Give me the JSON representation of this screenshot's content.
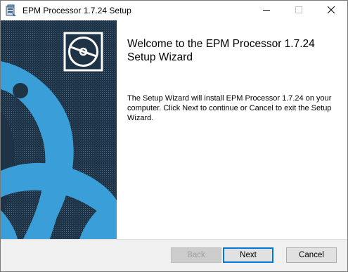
{
  "window": {
    "title": "EPM Processor 1.7.24 Setup"
  },
  "titlebar_controls": {
    "minimize_icon": "minimize-icon",
    "maximize_icon": "maximize-icon",
    "close_icon": "close-icon"
  },
  "wizard": {
    "heading": "Welcome to the EPM Processor 1.7.24 Setup Wizard",
    "description": "The Setup Wizard will install EPM Processor 1.7.24 on your computer. Click Next to continue or Cancel to exit the Setup Wizard."
  },
  "buttons": {
    "back": "Back",
    "next": "Next",
    "cancel": "Cancel"
  },
  "colors": {
    "banner_blue": "#3a9fd8",
    "banner_dark": "#1e3346",
    "accent": "#0078d7"
  }
}
